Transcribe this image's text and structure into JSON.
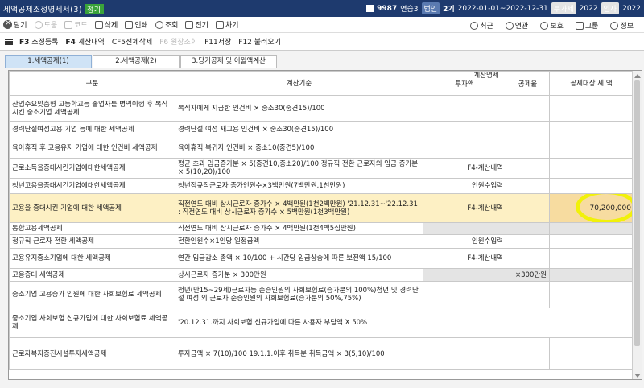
{
  "titlebar": {
    "title": "세액공제조정명세서(3)",
    "badge": "정기",
    "company_code": "9987",
    "company_name": "연습3",
    "corp_label": "법인",
    "term": "2기",
    "period": "2022-01-01~2022-12-31",
    "vat_label": "부가세",
    "vat_year": "2022",
    "tax_label": "인사",
    "tax_year": "2022"
  },
  "toolbar1": {
    "close": "닫기",
    "help": "도움",
    "code": "코드",
    "delete": "삭제",
    "print": "인쇄",
    "view": "조회",
    "etax": "전기",
    "next": "차기",
    "recent": "최근",
    "link": "연관",
    "protect": "보호",
    "group": "그룹",
    "info": "정보"
  },
  "toolbar2": {
    "items": [
      {
        "key": "F3",
        "label": "조정등록"
      },
      {
        "key": "F4",
        "label": "계산내역"
      },
      {
        "key": "CF5",
        "label": "전체삭제"
      },
      {
        "key": "F6",
        "label": "원장조회"
      },
      {
        "key": "F11",
        "label": "저장"
      },
      {
        "key": "F12",
        "label": "불러오기"
      }
    ]
  },
  "tabs": [
    {
      "label": "1.세액공제(1)"
    },
    {
      "label": "2.세액공제(2)"
    },
    {
      "label": "3.당기공제 및 이월액계산"
    }
  ],
  "table": {
    "headers": {
      "col1": "구분",
      "col2": "계산기준",
      "col3_group": "계산명세",
      "col3a": "투자액",
      "col3b": "공제율",
      "col4": "공제대상 세 액"
    },
    "rows": [
      {
        "name": "산업수요맞춤형 고등학교등 졸업자를 병역이행 후 복직시킨 중소기업 세액공제",
        "basis": "복직자에게 지급한 인건비 × 중소30(중견15)/100",
        "invest": "",
        "rate": "",
        "amount": ""
      },
      {
        "name": "경력단절여성고용 기업 등에 대한 세액공제",
        "basis": "경력단절 여성 재고용 인건비 × 중소30(중견15)/100",
        "invest": "",
        "rate": "",
        "amount": ""
      },
      {
        "name": "육아휴직 후 고용유지 기업에 대한 인건비 세액공제",
        "basis": "육아휴직 복귀자 인건비 × 중소10(중견5)/100",
        "invest": "",
        "rate": "",
        "amount": ""
      },
      {
        "name": "근로소득을증대시킨기업에대한세액공제",
        "basis": "평균 초과 임금증가분 × 5(중견10,중소20)/100 정규직 전환 근로자의 임금 증가분 × 5(10,20)/100",
        "invest": "F4-계산내역",
        "rate": "",
        "amount": ""
      },
      {
        "name": "청년고용을증대시킨기업에대한세액공제",
        "basis": "청년정규직근로자 증가인원수×3백만원(7백만원,1천만원)",
        "invest": "인원수입력",
        "rate": "",
        "amount": ""
      },
      {
        "name": "고용을 증대시킨 기업에 대한 세액공제",
        "basis": "직전연도 대비 상시근로자 증가수 × 4백만원(1천2백만원) '21.12.31~'22.12.31 : 직전연도 대비 상시근로자 증가수 × 5백만원(1천3백만원)",
        "invest": "F4-계산내역",
        "rate": "",
        "amount": "70,200,000",
        "highlight": true
      },
      {
        "name": "통합고용세액공제",
        "basis": "직전연도 대비 상시근로자 증가수 × 4백만원(1천4백5십만원)",
        "invest": "",
        "rate": "",
        "amount": "",
        "gray": true
      },
      {
        "name": "정규직 근로자 전환 세액공제",
        "basis": "전환인원수×1인당 일정금액",
        "invest": "인원수입력",
        "rate": "",
        "amount": ""
      },
      {
        "name": "고용유지중소기업에 대한 세액공제",
        "basis": "연간 임금감소 총액 × 10/100 + 시간당 임금상승에 따른 보전액 15/100",
        "invest": "F4-계산내역",
        "rate": "",
        "amount": ""
      },
      {
        "name": "고용증대 세액공제",
        "basis": "상시근로자 증가분 × 300만원",
        "invest": "",
        "rate": "×300만원",
        "amount": "",
        "gray": true
      },
      {
        "name": "중소기업 고용증가 인원에 대한 사회보험료 세액공제",
        "basis": "청년(만15~29세)근로자등 순증인원의 사회보험료(증가분의 100%)청년 및 경력단절 여성 외 근로자 순증인원의 사회보험료(증가분의 50%,75%)",
        "invest": "",
        "rate": "",
        "amount": ""
      },
      {
        "name": "중소기업 사회보험 신규가입에 대한 사회보험료 세액공제",
        "basis": "'20.12.31.까지 사회보험 신규가입에 따른 사용자 부담액 X 50%",
        "invest": "",
        "rate": "",
        "amount": ""
      },
      {
        "name": "근로자복지증진시설투자세액공제",
        "basis": "투자금액 × 7(10)/100 19.1.1.이후 취득분:취득금액 × 3(5,10)/100",
        "invest": "",
        "rate": "",
        "amount": ""
      }
    ]
  }
}
